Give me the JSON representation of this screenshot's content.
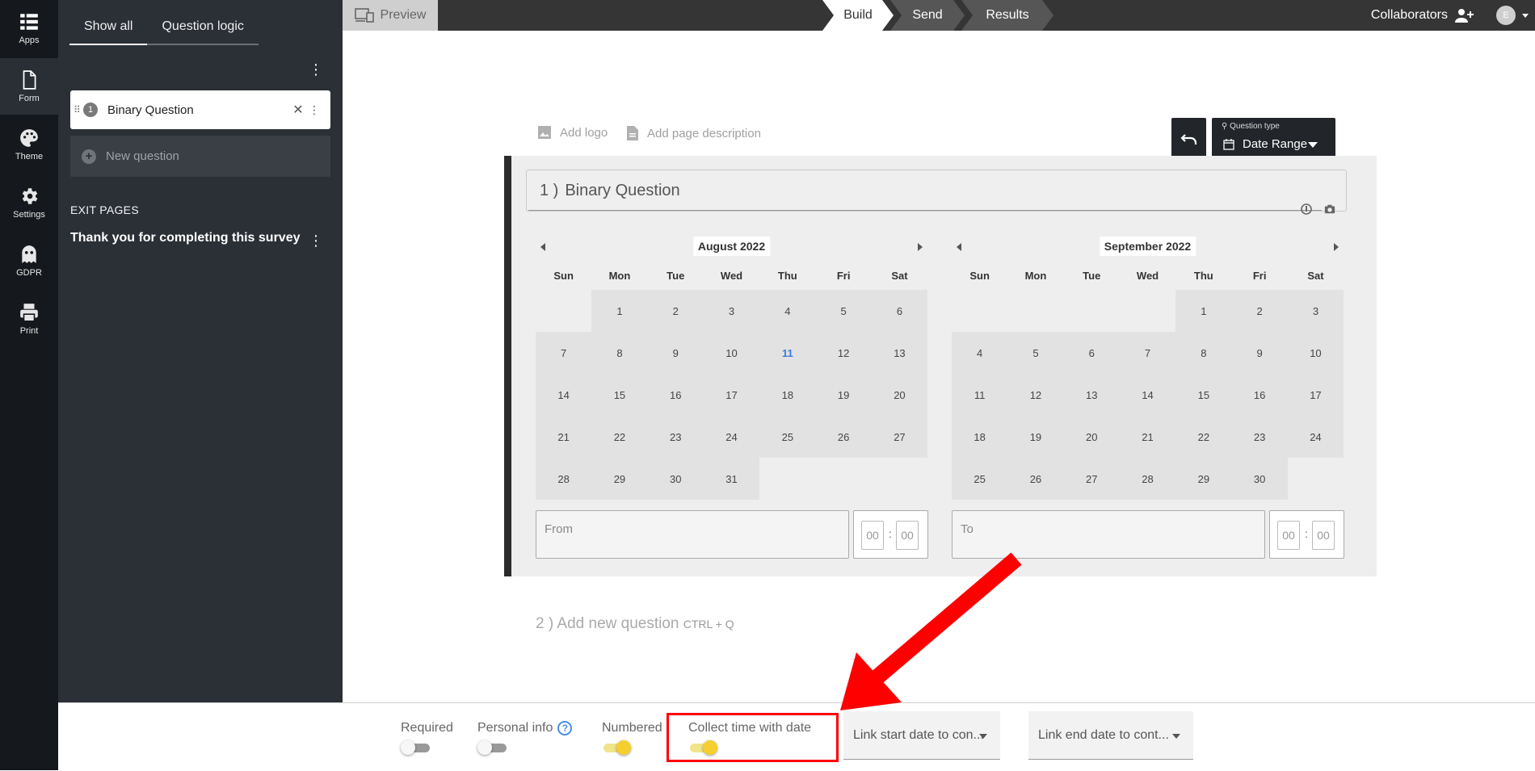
{
  "rail": {
    "items": [
      {
        "label": "Apps",
        "icon": "apps-grid-icon"
      },
      {
        "label": "Form",
        "icon": "form-document-icon"
      },
      {
        "label": "Theme",
        "icon": "palette-icon"
      },
      {
        "label": "Settings",
        "icon": "gear-icon"
      },
      {
        "label": "GDPR",
        "icon": "ghost-icon"
      },
      {
        "label": "Print",
        "icon": "printer-icon"
      }
    ]
  },
  "sidebar": {
    "tabs": [
      "Show all",
      "Question logic"
    ],
    "question": {
      "number": "1",
      "title": "Binary Question"
    },
    "new_question": "New question",
    "exit_heading": "EXIT PAGES",
    "exit_item": "Thank you for completing this survey"
  },
  "topbar": {
    "preview": "Preview",
    "steps": [
      "Build",
      "Send",
      "Results"
    ],
    "collaborators": "Collaborators",
    "avatar_initial": "E"
  },
  "canvas": {
    "add_logo": "Add logo",
    "add_description": "Add page description",
    "question_type_label": "Question type",
    "question_type_value": "Date Range",
    "question_number": "1 )",
    "question_title": "Binary Question",
    "add_new_number": "2 )",
    "add_new_text": "Add new question",
    "add_new_shortcut": "CTRL + Q"
  },
  "calendars": {
    "weekdays": [
      "Sun",
      "Mon",
      "Tue",
      "Wed",
      "Thu",
      "Fri",
      "Sat"
    ],
    "left": {
      "month": "August 2022",
      "first_weekday_index": 1,
      "days": 31,
      "today": 11,
      "input_label": "From",
      "time_hh": "00",
      "time_mm": "00"
    },
    "right": {
      "month": "September 2022",
      "first_weekday_index": 4,
      "days": 30,
      "today": null,
      "input_label": "To",
      "time_hh": "00",
      "time_mm": "00"
    }
  },
  "bottombar": {
    "required": {
      "label": "Required",
      "on": false
    },
    "personal_info": {
      "label": "Personal info",
      "help": "?",
      "on": false
    },
    "numbered": {
      "label": "Numbered",
      "on": true
    },
    "collect_time": {
      "label": "Collect time with date",
      "on": true
    },
    "link_start": "Link start date to con...",
    "link_end": "Link end date to cont..."
  },
  "colors": {
    "annotation": "#ff0000",
    "toggle_on": "#f5cf2f",
    "today": "#3b7be0"
  }
}
